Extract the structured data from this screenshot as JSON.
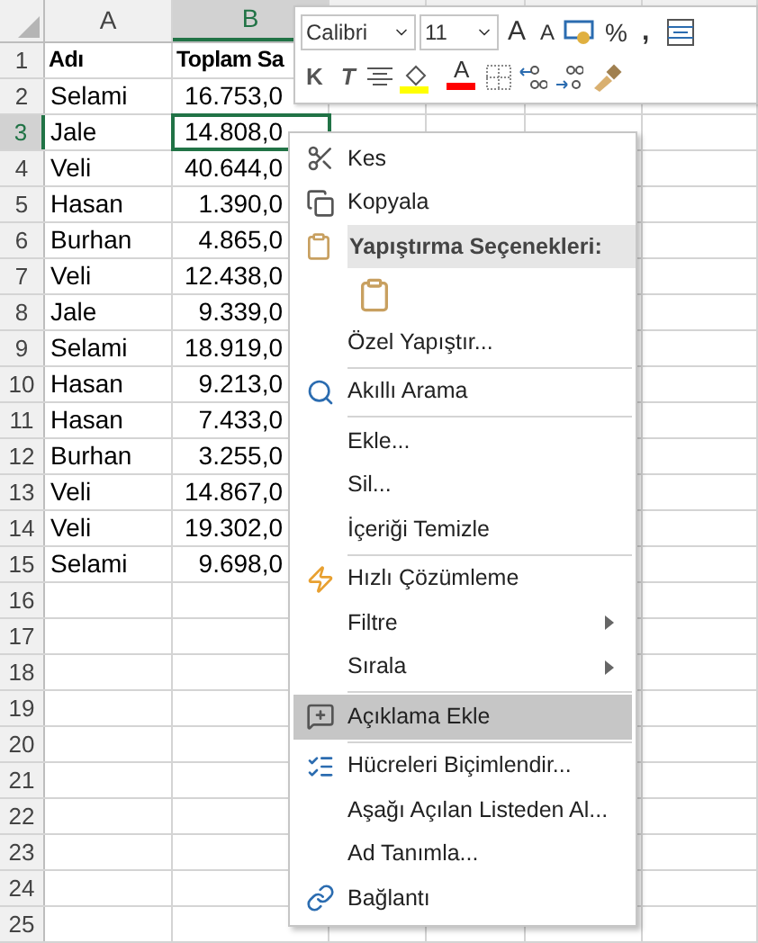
{
  "columns": [
    {
      "label": "A",
      "selected": false
    },
    {
      "label": "B",
      "selected": true
    }
  ],
  "rows": [
    {
      "number": "1",
      "selected": false,
      "bold": true,
      "cells": [
        "Adı",
        "Toplam Sa"
      ]
    },
    {
      "number": "2",
      "selected": false,
      "cells": [
        "Selami",
        "16.753,0"
      ]
    },
    {
      "number": "3",
      "selected": true,
      "cells": [
        "Jale",
        "14.808,0"
      ]
    },
    {
      "number": "4",
      "selected": false,
      "cells": [
        "Veli",
        "40.644,0"
      ]
    },
    {
      "number": "5",
      "selected": false,
      "cells": [
        "Hasan",
        "1.390,0"
      ]
    },
    {
      "number": "6",
      "selected": false,
      "cells": [
        "Burhan",
        "4.865,0"
      ]
    },
    {
      "number": "7",
      "selected": false,
      "cells": [
        "Veli",
        "12.438,0"
      ]
    },
    {
      "number": "8",
      "selected": false,
      "cells": [
        "Jale",
        "9.339,0"
      ]
    },
    {
      "number": "9",
      "selected": false,
      "cells": [
        "Selami",
        "18.919,0"
      ]
    },
    {
      "number": "10",
      "selected": false,
      "cells": [
        "Hasan",
        "9.213,0"
      ]
    },
    {
      "number": "11",
      "selected": false,
      "cells": [
        "Hasan",
        "7.433,0"
      ]
    },
    {
      "number": "12",
      "selected": false,
      "cells": [
        "Burhan",
        "3.255,0"
      ]
    },
    {
      "number": "13",
      "selected": false,
      "cells": [
        "Veli",
        "14.867,0"
      ]
    },
    {
      "number": "14",
      "selected": false,
      "cells": [
        "Veli",
        "19.302,0"
      ]
    },
    {
      "number": "15",
      "selected": false,
      "cells": [
        "Selami",
        "9.698,0"
      ]
    },
    {
      "number": "16",
      "selected": false
    },
    {
      "number": "17",
      "selected": false
    },
    {
      "number": "18",
      "selected": false
    },
    {
      "number": "19",
      "selected": false
    },
    {
      "number": "20",
      "selected": false
    },
    {
      "number": "21",
      "selected": false
    },
    {
      "number": "22",
      "selected": false
    },
    {
      "number": "23",
      "selected": false
    },
    {
      "number": "24",
      "selected": false
    },
    {
      "number": "25",
      "selected": false
    }
  ],
  "mini_toolbar": {
    "font": "Calibri",
    "size": "11",
    "grow_font": "A",
    "shrink_font": "A",
    "percent": "%",
    "comma": ",",
    "bold": "K",
    "italic": "T",
    "font_color": "A"
  },
  "context_menu": [
    {
      "kind": "item",
      "label": "Kes",
      "selected": false
    },
    {
      "kind": "item",
      "label": "Kopyala",
      "selected": false
    },
    {
      "kind": "header",
      "label": "Yapıştırma Seçenekleri:"
    },
    {
      "kind": "paste-options"
    },
    {
      "kind": "item",
      "label": "Özel Yapıştır...",
      "selected": false
    },
    {
      "kind": "separator"
    },
    {
      "kind": "item",
      "label": "Akıllı Arama",
      "selected": false
    },
    {
      "kind": "separator"
    },
    {
      "kind": "item",
      "label": "Ekle...",
      "selected": false
    },
    {
      "kind": "item",
      "label": "Sil...",
      "selected": false
    },
    {
      "kind": "item",
      "label": "İçeriği Temizle",
      "selected": false
    },
    {
      "kind": "separator"
    },
    {
      "kind": "item",
      "label": "Hızlı Çözümleme",
      "selected": false
    },
    {
      "kind": "item",
      "label": "Filtre",
      "submenu": true,
      "selected": false
    },
    {
      "kind": "item",
      "label": "Sırala",
      "submenu": true,
      "selected": false
    },
    {
      "kind": "separator"
    },
    {
      "kind": "item",
      "label": "Açıklama Ekle",
      "selected": true
    },
    {
      "kind": "separator"
    },
    {
      "kind": "item",
      "label": "Hücreleri Biçimlendir...",
      "selected": false
    },
    {
      "kind": "item",
      "label": "Aşağı Açılan Listeden Al...",
      "selected": false
    },
    {
      "kind": "item",
      "label": "Ad Tanımla...",
      "selected": false
    },
    {
      "kind": "item",
      "label": "Bağlantı",
      "selected": false
    }
  ]
}
